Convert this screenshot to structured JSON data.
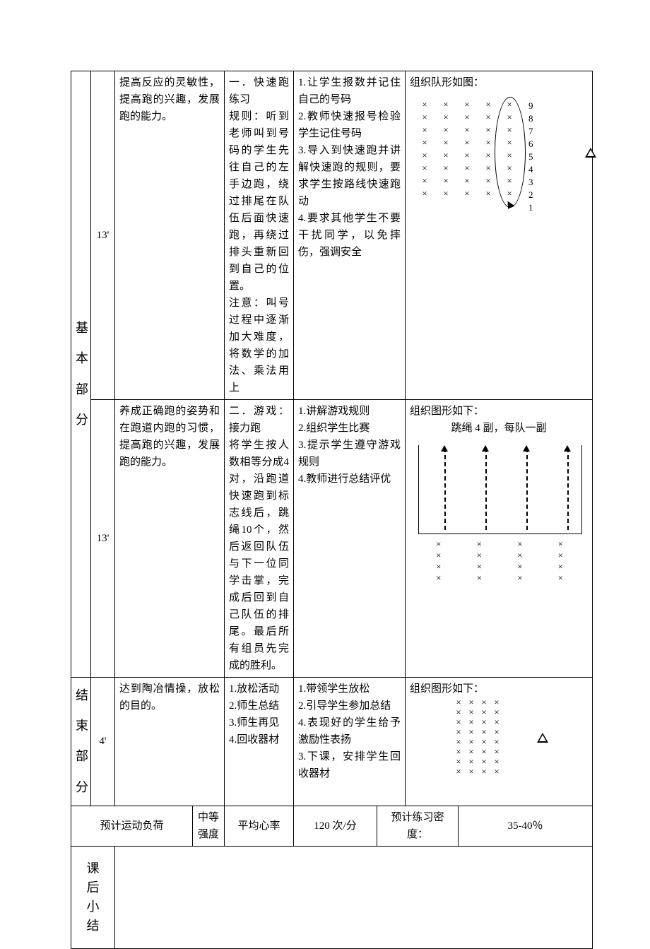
{
  "sections": {
    "basic_label": [
      "基",
      "本",
      "部",
      "分"
    ],
    "end_label": [
      "结",
      "束",
      "部",
      "分"
    ],
    "summary_label": [
      "课",
      "后",
      "小",
      "结"
    ]
  },
  "row1": {
    "time": "13'",
    "goal": "提高反应的灵敏性，提高跑的兴趣，发展跑的能力。",
    "contentA": "一．快速跑练习",
    "contentB": "规则：听到老师叫到号码的学生先往自己的左手边跑，绕过排尾在队伍后面快速跑，再绕过排头重新回到自己的位置。",
    "contentC": "注意：叫号过程中逐渐加大难度，将数学的加法、乘法用上",
    "teach1": "1.让学生报数并记住自己的号码",
    "teach2": "2.教师快速报号检验学生记住号码",
    "teach3": "3.导入到快速跑并讲解快速跑的规则，要求学生按路线快速跑动",
    "teach4": "4.要求其他学生不要干扰同学，以免摔伤，强调安全",
    "org_title": "组织队形如图：",
    "numbers": [
      "9",
      "8",
      "7",
      "6",
      "5",
      "4",
      "3",
      "2",
      "1"
    ]
  },
  "row2": {
    "time": "13'",
    "goal": "养成正确跑的姿势和在跑道内跑的习惯，提高跑的兴趣，发展跑的能力。",
    "contentA": "二．游戏：接力跑",
    "contentB": "将学生按人数相等分成4对，沿跑道快速跑到标志线后，跳绳10个，然后返回队伍与下一位同学击掌，完成后回到自己队伍的排尾。最后所有组员先完成的胜利。",
    "teach1": "1.讲解游戏规则",
    "teach2": "2.组织学生比赛",
    "teach3": "3.提示学生遵守游戏规则",
    "teach4": "4.教师进行总结评优",
    "org_title": "组织图形如下：",
    "org_sub": "跳绳 4 副，每队一副"
  },
  "row3": {
    "time": "4'",
    "goal": "达到陶冶情操，放松的目的。",
    "content1": "1.放松活动",
    "content2": "2.师生总结",
    "content3": "3.师生再见",
    "content4": "4.回收器材",
    "teach1": "1.带领学生放松",
    "teach2": "2.引导学生参加总结",
    "teach3": "4.表现好的学生给予激励性表扬",
    "teach4": "3.下课，安排学生回收器材",
    "org_title": "组织图形如下："
  },
  "footer": {
    "label_load": "预计运动负荷",
    "load_val": "中等强度",
    "label_hr": "平均心率",
    "hr_val": "120 次/分",
    "label_density": "预计练习密度：",
    "density_val": "35-40％"
  },
  "glyphs": {
    "x": "×"
  }
}
